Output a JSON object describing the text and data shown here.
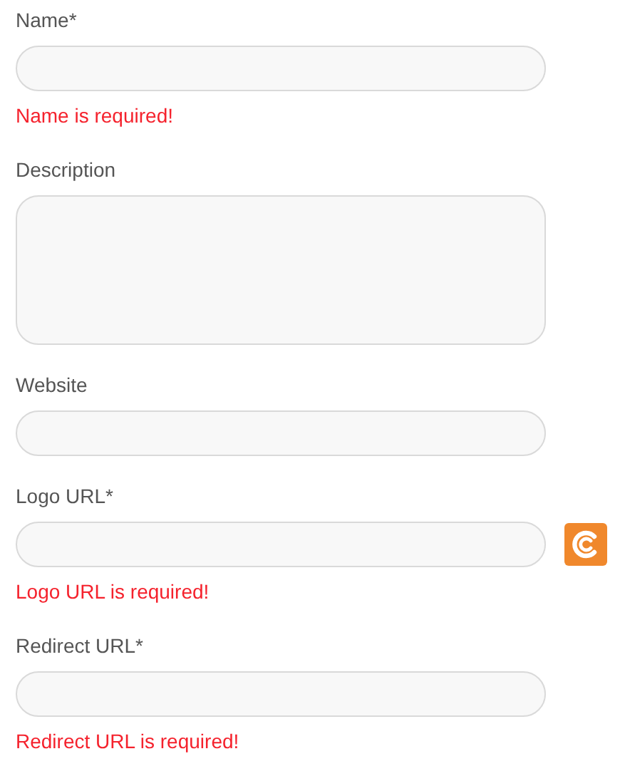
{
  "fields": [
    {
      "label": "Name*",
      "kind": "input",
      "error": "Name is required!"
    },
    {
      "label": "Description",
      "kind": "textarea"
    },
    {
      "label": "Website",
      "kind": "input"
    },
    {
      "label": "Logo URL*",
      "kind": "input",
      "error": "Logo URL is required!",
      "addon": {
        "kind": "logo"
      }
    },
    {
      "label": "Redirect URL*",
      "kind": "input",
      "error": "Redirect URL is required!"
    }
  ]
}
